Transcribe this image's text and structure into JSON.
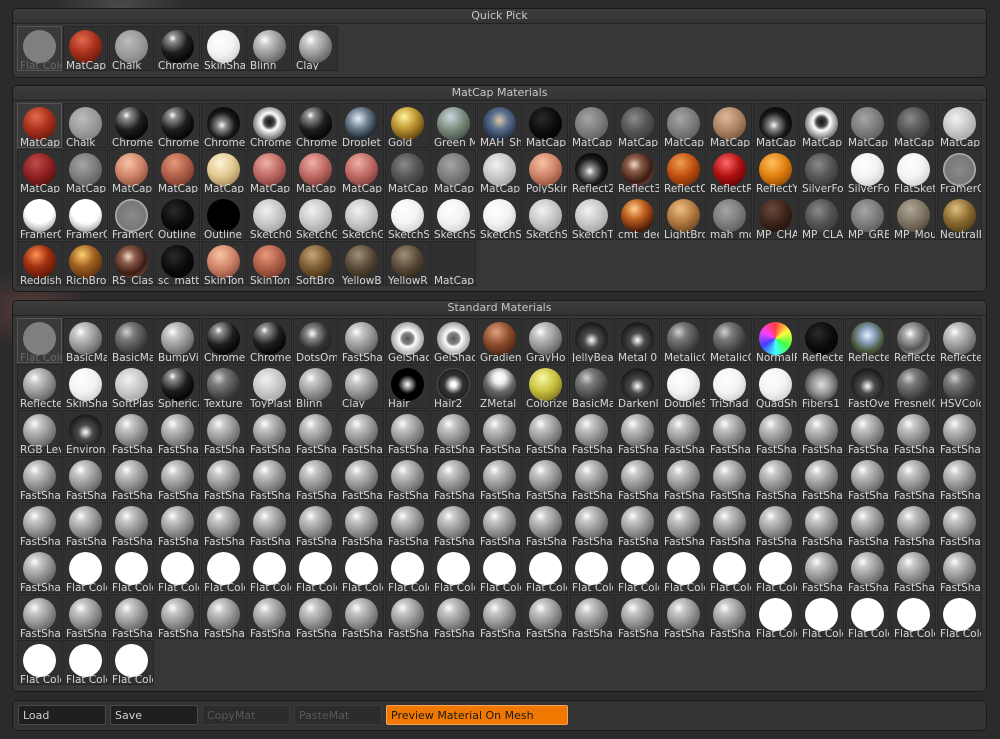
{
  "quick_pick": {
    "title": "Quick Pick",
    "items": [
      {
        "label": "Flat Colo",
        "sphere": "flatgrey",
        "dim": true
      },
      {
        "label": "MatCap",
        "sphere": "red"
      },
      {
        "label": "Chalk",
        "sphere": "chalk"
      },
      {
        "label": "Chrome",
        "sphere": "chrome"
      },
      {
        "label": "SkinSha",
        "sphere": "white"
      },
      {
        "label": "Blinn",
        "sphere": "std"
      },
      {
        "label": "Clay",
        "sphere": "std"
      }
    ]
  },
  "matcap_materials": {
    "title": "MatCap Materials",
    "items": [
      {
        "label": "MatCap",
        "sphere": "red"
      },
      {
        "label": "Chalk",
        "sphere": "chalk"
      },
      {
        "label": "Chrome",
        "sphere": "chrome"
      },
      {
        "label": "Chrome",
        "sphere": "chrome"
      },
      {
        "label": "Chrome",
        "sphere": "chromeb"
      },
      {
        "label": "Chrome",
        "sphere": "chromew"
      },
      {
        "label": "Chrome",
        "sphere": "chrome"
      },
      {
        "label": "Droplet",
        "sphere": "droplet"
      },
      {
        "label": "Gold",
        "sphere": "gold"
      },
      {
        "label": "Green M",
        "sphere": "bluegrey"
      },
      {
        "label": "MAH_Sh",
        "sphere": "mah"
      },
      {
        "label": "MatCap",
        "sphere": "black"
      },
      {
        "label": "MatCap",
        "sphere": "grey"
      },
      {
        "label": "MatCap",
        "sphere": "darkgrey"
      },
      {
        "label": "MatCap",
        "sphere": "grey"
      },
      {
        "label": "MatCap",
        "sphere": "tan"
      },
      {
        "label": "MatCap",
        "sphere": "chromeb"
      },
      {
        "label": "MatCap",
        "sphere": "chromew"
      },
      {
        "label": "MatCap",
        "sphere": "grey"
      },
      {
        "label": "MatCap",
        "sphere": "darkgrey"
      },
      {
        "label": "MatCap",
        "sphere": "lightgrey"
      },
      {
        "label": "MatCap",
        "sphere": "red2"
      },
      {
        "label": "MatCap",
        "sphere": "grey"
      },
      {
        "label": "MatCap",
        "sphere": "skin"
      },
      {
        "label": "MatCap",
        "sphere": "skin2"
      },
      {
        "label": "MatCap",
        "sphere": "cream"
      },
      {
        "label": "MatCap",
        "sphere": "pinkred"
      },
      {
        "label": "MatCap",
        "sphere": "pinkred"
      },
      {
        "label": "MatCap",
        "sphere": "pinkred"
      },
      {
        "label": "MatCap",
        "sphere": "darkgrey"
      },
      {
        "label": "MatCap",
        "sphere": "grey"
      },
      {
        "label": "MatCap",
        "sphere": "lightgrey"
      },
      {
        "label": "PolySkin",
        "sphere": "skin"
      },
      {
        "label": "Reflect2",
        "sphere": "chromeb"
      },
      {
        "label": "Reflect3",
        "sphere": "brownchrome"
      },
      {
        "label": "ReflectO",
        "sphere": "orange"
      },
      {
        "label": "ReflectR",
        "sphere": "red3"
      },
      {
        "label": "ReflectY",
        "sphere": "orange2"
      },
      {
        "label": "SilverFo",
        "sphere": "darkgrey"
      },
      {
        "label": "SilverFo",
        "sphere": "white"
      },
      {
        "label": "FlatSket",
        "sphere": "white"
      },
      {
        "label": "FramerO",
        "sphere": "framer"
      },
      {
        "label": "FramerO",
        "sphere": "whitelow"
      },
      {
        "label": "FramerO",
        "sphere": "whitelow"
      },
      {
        "label": "FramerO",
        "sphere": "framer"
      },
      {
        "label": "Outline",
        "sphere": "black"
      },
      {
        "label": "Outline",
        "sphere": "outline"
      },
      {
        "label": "Sketch0",
        "sphere": "lightgrey"
      },
      {
        "label": "SketchG",
        "sphere": "lightgrey"
      },
      {
        "label": "SketchG",
        "sphere": "lightgrey"
      },
      {
        "label": "SketchS",
        "sphere": "white"
      },
      {
        "label": "SketchS",
        "sphere": "white"
      },
      {
        "label": "SketchS",
        "sphere": "white"
      },
      {
        "label": "SketchS",
        "sphere": "lightgrey"
      },
      {
        "label": "SketchT",
        "sphere": "lightgrey"
      },
      {
        "label": "cmt_dee",
        "sphere": "copper"
      },
      {
        "label": "LightBro",
        "sphere": "lightbrown"
      },
      {
        "label": "mah_mo",
        "sphere": "grey"
      },
      {
        "label": "MP_CHA",
        "sphere": "darkbrown"
      },
      {
        "label": "MP_CLA",
        "sphere": "darkgrey"
      },
      {
        "label": "MP_GRE",
        "sphere": "grey"
      },
      {
        "label": "MP_Mou",
        "sphere": "greybrown"
      },
      {
        "label": "NeutralB",
        "sphere": "bronze"
      },
      {
        "label": "Reddish",
        "sphere": "reddish"
      },
      {
        "label": "RichBro",
        "sphere": "richbrown"
      },
      {
        "label": "RS_Clas",
        "sphere": "brownchrome"
      },
      {
        "label": "sc_matt",
        "sphere": "black"
      },
      {
        "label": "SkinTon",
        "sphere": "skin"
      },
      {
        "label": "SkinTon",
        "sphere": "skin2"
      },
      {
        "label": "SoftBro",
        "sphere": "softbrown"
      },
      {
        "label": "YellowB",
        "sphere": "yellowb"
      },
      {
        "label": "YellowR",
        "sphere": "yellowb"
      },
      {
        "label": "MatCap",
        "sphere": "none"
      }
    ]
  },
  "standard_materials": {
    "title": "Standard Materials",
    "items": [
      {
        "label": "Flat Colo",
        "sphere": "flatgrey",
        "dim": true
      },
      {
        "label": "BasicMa",
        "sphere": "std"
      },
      {
        "label": "BasicMa",
        "sphere": "darkstd"
      },
      {
        "label": "BumpVie",
        "sphere": "std"
      },
      {
        "label": "Chrome",
        "sphere": "chrome"
      },
      {
        "label": "Chrome",
        "sphere": "chrome"
      },
      {
        "label": "DotsOm",
        "sphere": "dots"
      },
      {
        "label": "FastSha",
        "sphere": "std"
      },
      {
        "label": "GelShac",
        "sphere": "gel"
      },
      {
        "label": "GelShac",
        "sphere": "gel"
      },
      {
        "label": "Gradien",
        "sphere": "gradien"
      },
      {
        "label": "GrayHo",
        "sphere": "std"
      },
      {
        "label": "JellyBea",
        "sphere": "jelly"
      },
      {
        "label": "Metal 0",
        "sphere": "jelly"
      },
      {
        "label": "MetalicC",
        "sphere": "darkstd"
      },
      {
        "label": "MetalicC",
        "sphere": "darkstd"
      },
      {
        "label": "NormalR",
        "sphere": "normal"
      },
      {
        "label": "Reflecte",
        "sphere": "black"
      },
      {
        "label": "Reflecte",
        "sphere": "sky"
      },
      {
        "label": "Reflecte",
        "sphere": "glass"
      },
      {
        "label": "Reflecte",
        "sphere": "std"
      },
      {
        "label": "Reflecte",
        "sphere": "std"
      },
      {
        "label": "SkinSha",
        "sphere": "white"
      },
      {
        "label": "SoftPlas",
        "sphere": "lightgrey"
      },
      {
        "label": "Spherica",
        "sphere": "chrome"
      },
      {
        "label": "Texture",
        "sphere": "darkstd"
      },
      {
        "label": "ToyPlast",
        "sphere": "lightgrey"
      },
      {
        "label": "Blinn",
        "sphere": "std"
      },
      {
        "label": "Clay",
        "sphere": "std"
      },
      {
        "label": "Hair",
        "sphere": "hair"
      },
      {
        "label": "Hair2",
        "sphere": "hair2"
      },
      {
        "label": "ZMetal",
        "sphere": "zmetal"
      },
      {
        "label": "Colorize",
        "sphere": "yellow"
      },
      {
        "label": "BasicMa",
        "sphere": "darkstd"
      },
      {
        "label": "Darkenl",
        "sphere": "jelly"
      },
      {
        "label": "DoubleS",
        "sphere": "white"
      },
      {
        "label": "TriShad",
        "sphere": "white"
      },
      {
        "label": "QuadSh",
        "sphere": "white"
      },
      {
        "label": "Fibers1",
        "sphere": "fibers"
      },
      {
        "label": "FastOve",
        "sphere": "jelly"
      },
      {
        "label": "FresnelC",
        "sphere": "darkstd"
      },
      {
        "label": "HSVColo",
        "sphere": "darkstd"
      },
      {
        "label": "RGB Lev",
        "sphere": "std"
      },
      {
        "label": "Environ",
        "sphere": "jelly"
      },
      {
        "label": "FastSha",
        "sphere": "std"
      },
      {
        "label": "FastSha",
        "sphere": "std"
      },
      {
        "label": "FastSha",
        "sphere": "std"
      },
      {
        "label": "FastSha",
        "sphere": "std"
      },
      {
        "label": "FastSha",
        "sphere": "std"
      },
      {
        "label": "FastSha",
        "sphere": "std"
      },
      {
        "label": "FastSha",
        "sphere": "std"
      },
      {
        "label": "FastSha",
        "sphere": "std"
      },
      {
        "label": "FastSha",
        "sphere": "std"
      },
      {
        "label": "FastSha",
        "sphere": "std"
      },
      {
        "label": "FastSha",
        "sphere": "std"
      },
      {
        "label": "FastSha",
        "sphere": "std"
      },
      {
        "label": "FastSha",
        "sphere": "std"
      },
      {
        "label": "FastSha",
        "sphere": "std"
      },
      {
        "label": "FastSha",
        "sphere": "std"
      },
      {
        "label": "FastSha",
        "sphere": "std"
      },
      {
        "label": "FastSha",
        "sphere": "std"
      },
      {
        "label": "FastSha",
        "sphere": "std"
      },
      {
        "label": "FastSha",
        "sphere": "std"
      },
      {
        "label": "FastSha",
        "sphere": "std"
      },
      {
        "label": "FastSha",
        "sphere": "std"
      },
      {
        "label": "FastSha",
        "sphere": "std"
      },
      {
        "label": "FastSha",
        "sphere": "std"
      },
      {
        "label": "FastSha",
        "sphere": "std"
      },
      {
        "label": "FastSha",
        "sphere": "std"
      },
      {
        "label": "FastSha",
        "sphere": "std"
      },
      {
        "label": "FastSha",
        "sphere": "std"
      },
      {
        "label": "FastSha",
        "sphere": "std"
      },
      {
        "label": "FastSha",
        "sphere": "std"
      },
      {
        "label": "FastSha",
        "sphere": "std"
      },
      {
        "label": "FastSha",
        "sphere": "std"
      },
      {
        "label": "FastSha",
        "sphere": "std"
      },
      {
        "label": "FastSha",
        "sphere": "std"
      },
      {
        "label": "FastSha",
        "sphere": "std"
      },
      {
        "label": "FastSha",
        "sphere": "std"
      },
      {
        "label": "FastSha",
        "sphere": "std"
      },
      {
        "label": "FastSha",
        "sphere": "std"
      },
      {
        "label": "FastSha",
        "sphere": "std"
      },
      {
        "label": "FastSha",
        "sphere": "std"
      },
      {
        "label": "FastSha",
        "sphere": "std"
      },
      {
        "label": "FastSha",
        "sphere": "std"
      },
      {
        "label": "FastSha",
        "sphere": "std"
      },
      {
        "label": "FastSha",
        "sphere": "std"
      },
      {
        "label": "FastSha",
        "sphere": "std"
      },
      {
        "label": "FastSha",
        "sphere": "std"
      },
      {
        "label": "FastSha",
        "sphere": "std"
      },
      {
        "label": "FastSha",
        "sphere": "std"
      },
      {
        "label": "FastSha",
        "sphere": "std"
      },
      {
        "label": "FastSha",
        "sphere": "std"
      },
      {
        "label": "FastSha",
        "sphere": "std"
      },
      {
        "label": "FastSha",
        "sphere": "std"
      },
      {
        "label": "FastSha",
        "sphere": "std"
      },
      {
        "label": "FastSha",
        "sphere": "std"
      },
      {
        "label": "FastSha",
        "sphere": "std"
      },
      {
        "label": "FastSha",
        "sphere": "std"
      },
      {
        "label": "FastSha",
        "sphere": "std"
      },
      {
        "label": "FastSha",
        "sphere": "std"
      },
      {
        "label": "FastSha",
        "sphere": "std"
      },
      {
        "label": "FastSha",
        "sphere": "std"
      },
      {
        "label": "FastSha",
        "sphere": "std"
      },
      {
        "label": "FastSha",
        "sphere": "std"
      },
      {
        "label": "FastSha",
        "sphere": "std"
      },
      {
        "label": "Flat Colo",
        "sphere": "flatwhite"
      },
      {
        "label": "Flat Colo",
        "sphere": "flatwhite"
      },
      {
        "label": "Flat Colo",
        "sphere": "flatwhite"
      },
      {
        "label": "Flat Colo",
        "sphere": "flatwhite"
      },
      {
        "label": "Flat Colo",
        "sphere": "flatwhite"
      },
      {
        "label": "Flat Colo",
        "sphere": "flatwhite"
      },
      {
        "label": "Flat Colo",
        "sphere": "flatwhite"
      },
      {
        "label": "Flat Colo",
        "sphere": "flatwhite"
      },
      {
        "label": "Flat Colo",
        "sphere": "flatwhite"
      },
      {
        "label": "Flat Colo",
        "sphere": "flatwhite"
      },
      {
        "label": "Flat Colo",
        "sphere": "flatwhite"
      },
      {
        "label": "Flat Colo",
        "sphere": "flatwhite"
      },
      {
        "label": "Flat Colo",
        "sphere": "flatwhite"
      },
      {
        "label": "Flat Colo",
        "sphere": "flatwhite"
      },
      {
        "label": "Flat Colo",
        "sphere": "flatwhite"
      },
      {
        "label": "Flat Colo",
        "sphere": "flatwhite"
      },
      {
        "label": "FastSha",
        "sphere": "std"
      },
      {
        "label": "FastSha",
        "sphere": "std"
      },
      {
        "label": "FastSha",
        "sphere": "std"
      },
      {
        "label": "FastSha",
        "sphere": "std"
      },
      {
        "label": "FastSha",
        "sphere": "std"
      },
      {
        "label": "FastSha",
        "sphere": "std"
      },
      {
        "label": "FastSha",
        "sphere": "std"
      },
      {
        "label": "FastSha",
        "sphere": "std"
      },
      {
        "label": "FastSha",
        "sphere": "std"
      },
      {
        "label": "FastSha",
        "sphere": "std"
      },
      {
        "label": "FastSha",
        "sphere": "std"
      },
      {
        "label": "FastSha",
        "sphere": "std"
      },
      {
        "label": "FastSha",
        "sphere": "std"
      },
      {
        "label": "FastSha",
        "sphere": "std"
      },
      {
        "label": "FastSha",
        "sphere": "std"
      },
      {
        "label": "FastSha",
        "sphere": "std"
      },
      {
        "label": "FastSha",
        "sphere": "std"
      },
      {
        "label": "FastSha",
        "sphere": "std"
      },
      {
        "label": "FastSha",
        "sphere": "std"
      },
      {
        "label": "FastSha",
        "sphere": "std"
      },
      {
        "label": "Flat Colo",
        "sphere": "flatwhite"
      },
      {
        "label": "Flat Colo",
        "sphere": "flatwhite"
      },
      {
        "label": "Flat Colo",
        "sphere": "flatwhite"
      },
      {
        "label": "Flat Colo",
        "sphere": "flatwhite"
      },
      {
        "label": "Flat Colo",
        "sphere": "flatwhite"
      },
      {
        "label": "Flat Colo",
        "sphere": "flatwhite"
      },
      {
        "label": "Flat Colo",
        "sphere": "flatwhite"
      },
      {
        "label": "Flat Colo",
        "sphere": "flatwhite"
      }
    ]
  },
  "bottom_bar": {
    "load": "Load",
    "save": "Save",
    "copymat": "CopyMat",
    "pastemat": "PasteMat",
    "preview": "Preview Material On Mesh"
  },
  "colors": {
    "accent": "#f07800",
    "panel": "#373737",
    "background": "#2a2a2a"
  }
}
